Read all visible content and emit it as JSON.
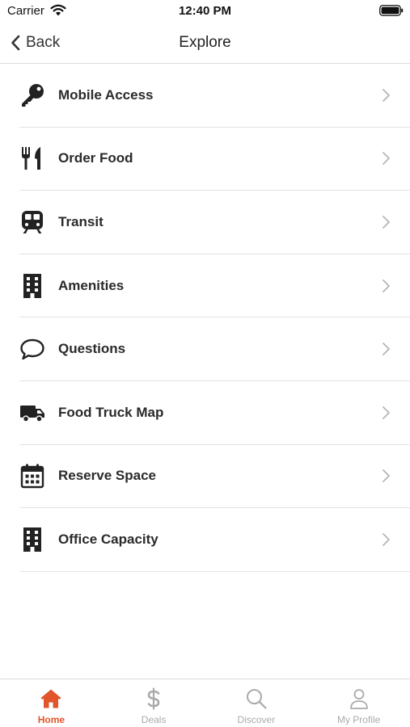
{
  "status_bar": {
    "carrier": "Carrier",
    "time": "12:40 PM"
  },
  "nav": {
    "back_label": "Back",
    "title": "Explore"
  },
  "menu": {
    "items": [
      {
        "label": "Mobile Access",
        "icon": "key-icon"
      },
      {
        "label": "Order Food",
        "icon": "fork-knife-icon"
      },
      {
        "label": "Transit",
        "icon": "train-icon"
      },
      {
        "label": "Amenities",
        "icon": "building-icon"
      },
      {
        "label": "Questions",
        "icon": "speech-bubble-icon"
      },
      {
        "label": "Food Truck Map",
        "icon": "truck-icon"
      },
      {
        "label": "Reserve Space",
        "icon": "calendar-icon"
      },
      {
        "label": "Office Capacity",
        "icon": "building-icon"
      }
    ]
  },
  "tabs": [
    {
      "label": "Home",
      "icon": "home-icon",
      "active": true
    },
    {
      "label": "Deals",
      "icon": "dollar-icon",
      "active": false
    },
    {
      "label": "Discover",
      "icon": "search-icon",
      "active": false
    },
    {
      "label": "My Profile",
      "icon": "person-icon",
      "active": false
    }
  ],
  "colors": {
    "accent": "#e2542a",
    "inactive": "#aaaaaa",
    "icon": "#222222"
  }
}
